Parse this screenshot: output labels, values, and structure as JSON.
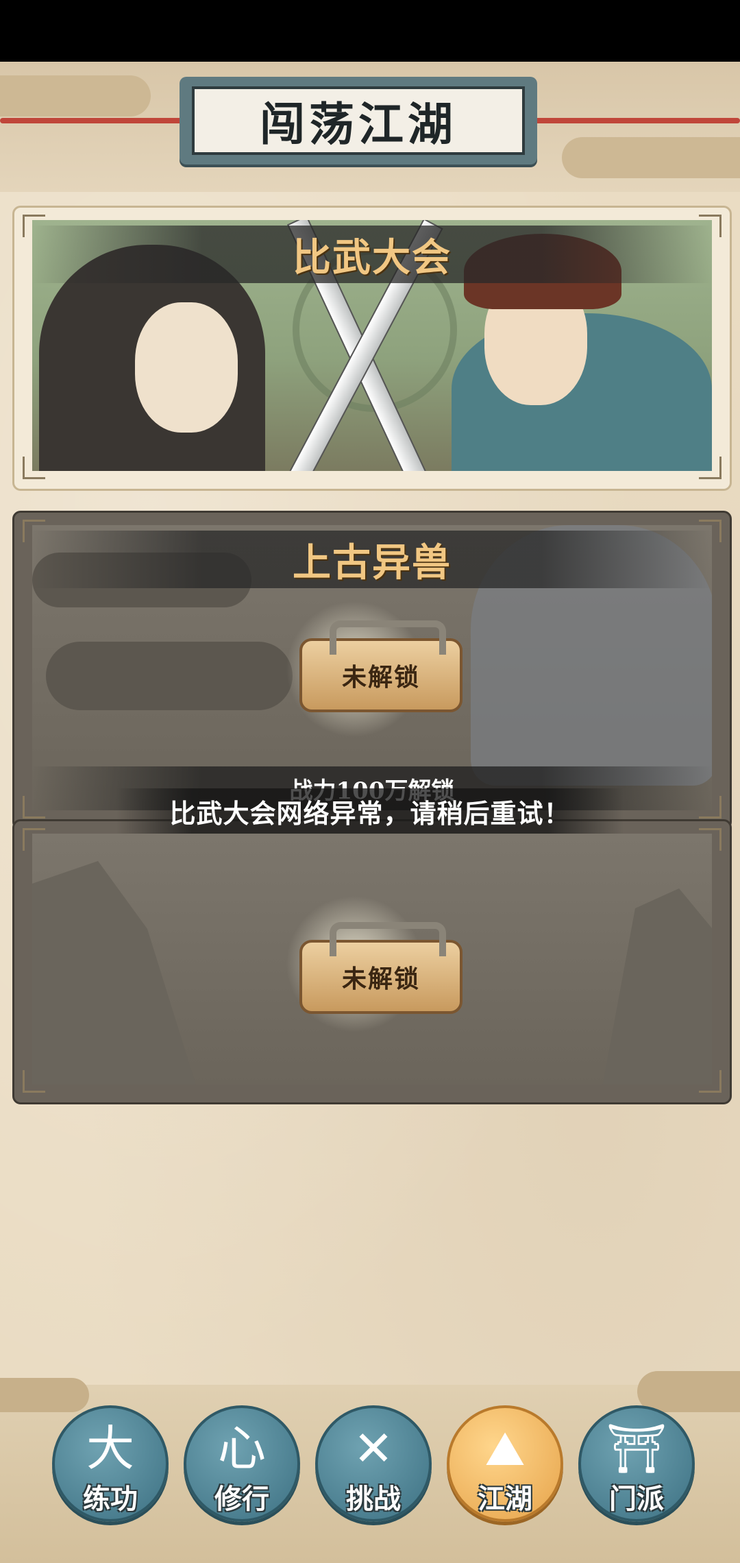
{
  "header": {
    "title": "闯荡江湖"
  },
  "cards": [
    {
      "title": "比武大会"
    },
    {
      "title": "上古异兽",
      "lock_label": "未解锁",
      "unlock_requirement": "战力100万解锁"
    },
    {
      "title": "",
      "lock_label": "未解锁"
    }
  ],
  "toast": {
    "message": "比武大会网络异常，请稍后重试！"
  },
  "nav": {
    "items": [
      {
        "label": "练功",
        "icon": "martial-artist-icon",
        "glyph": "大"
      },
      {
        "label": "修行",
        "icon": "heart-icon",
        "glyph": "心"
      },
      {
        "label": "挑战",
        "icon": "crossed-swords-icon",
        "glyph": "✕"
      },
      {
        "label": "江湖",
        "icon": "mountain-icon",
        "glyph": "⛰"
      },
      {
        "label": "门派",
        "icon": "gate-icon",
        "glyph": "⛩"
      }
    ],
    "active_index": 3
  },
  "colors": {
    "accent_gold": "#f1c783",
    "nav_blue": "#4f8596",
    "nav_active": "#f0b35a"
  }
}
